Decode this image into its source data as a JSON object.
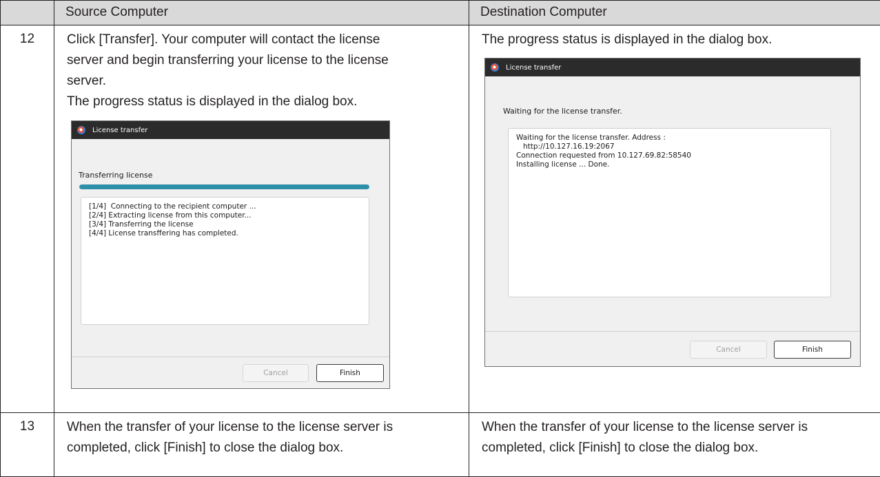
{
  "table": {
    "header": {
      "step": "",
      "source": "Source Computer",
      "destination": "Destination Computer"
    },
    "rows": [
      {
        "step": "12",
        "source": {
          "lines": [
            "Click [Transfer]. Your computer will contact the license",
            "server and begin transferring your license to the license",
            "server.",
            "The progress status is displayed in the dialog box."
          ],
          "dialog": {
            "title": "License transfer",
            "heading": "Transferring license",
            "progress": 1.0,
            "log": [
              "[1/4]  Connecting to the recipient computer ...",
              "[2/4] Extracting license from this computer...",
              "[3/4] Transferring the license",
              "[4/4] License transffering has completed."
            ],
            "cancel_label": "Cancel",
            "finish_label": "Finish"
          }
        },
        "destination": {
          "lines": [
            "The progress status is displayed in the dialog box."
          ],
          "dialog": {
            "title": "License transfer",
            "heading": "Waiting for the license transfer.",
            "log": [
              "Waiting for the license transfer. Address :",
              "   http://10.127.16.19:2067",
              "Connection requested from 10.127.69.82:58540",
              "Installing license ... Done."
            ],
            "cancel_label": "Cancel",
            "finish_label": "Finish"
          }
        }
      },
      {
        "step": "13",
        "source": {
          "lines": [
            "When the transfer of your license to the license server is",
            "completed, click [Finish] to close the dialog box."
          ]
        },
        "destination": {
          "lines": [
            "When the transfer of your license to the license server is",
            "completed, click [Finish] to close the dialog box."
          ]
        }
      }
    ]
  },
  "colors": {
    "header_bg": "#d9d9d9",
    "titlebar_bg": "#2b2b2b",
    "progress_fill": "#2e8fa8"
  }
}
